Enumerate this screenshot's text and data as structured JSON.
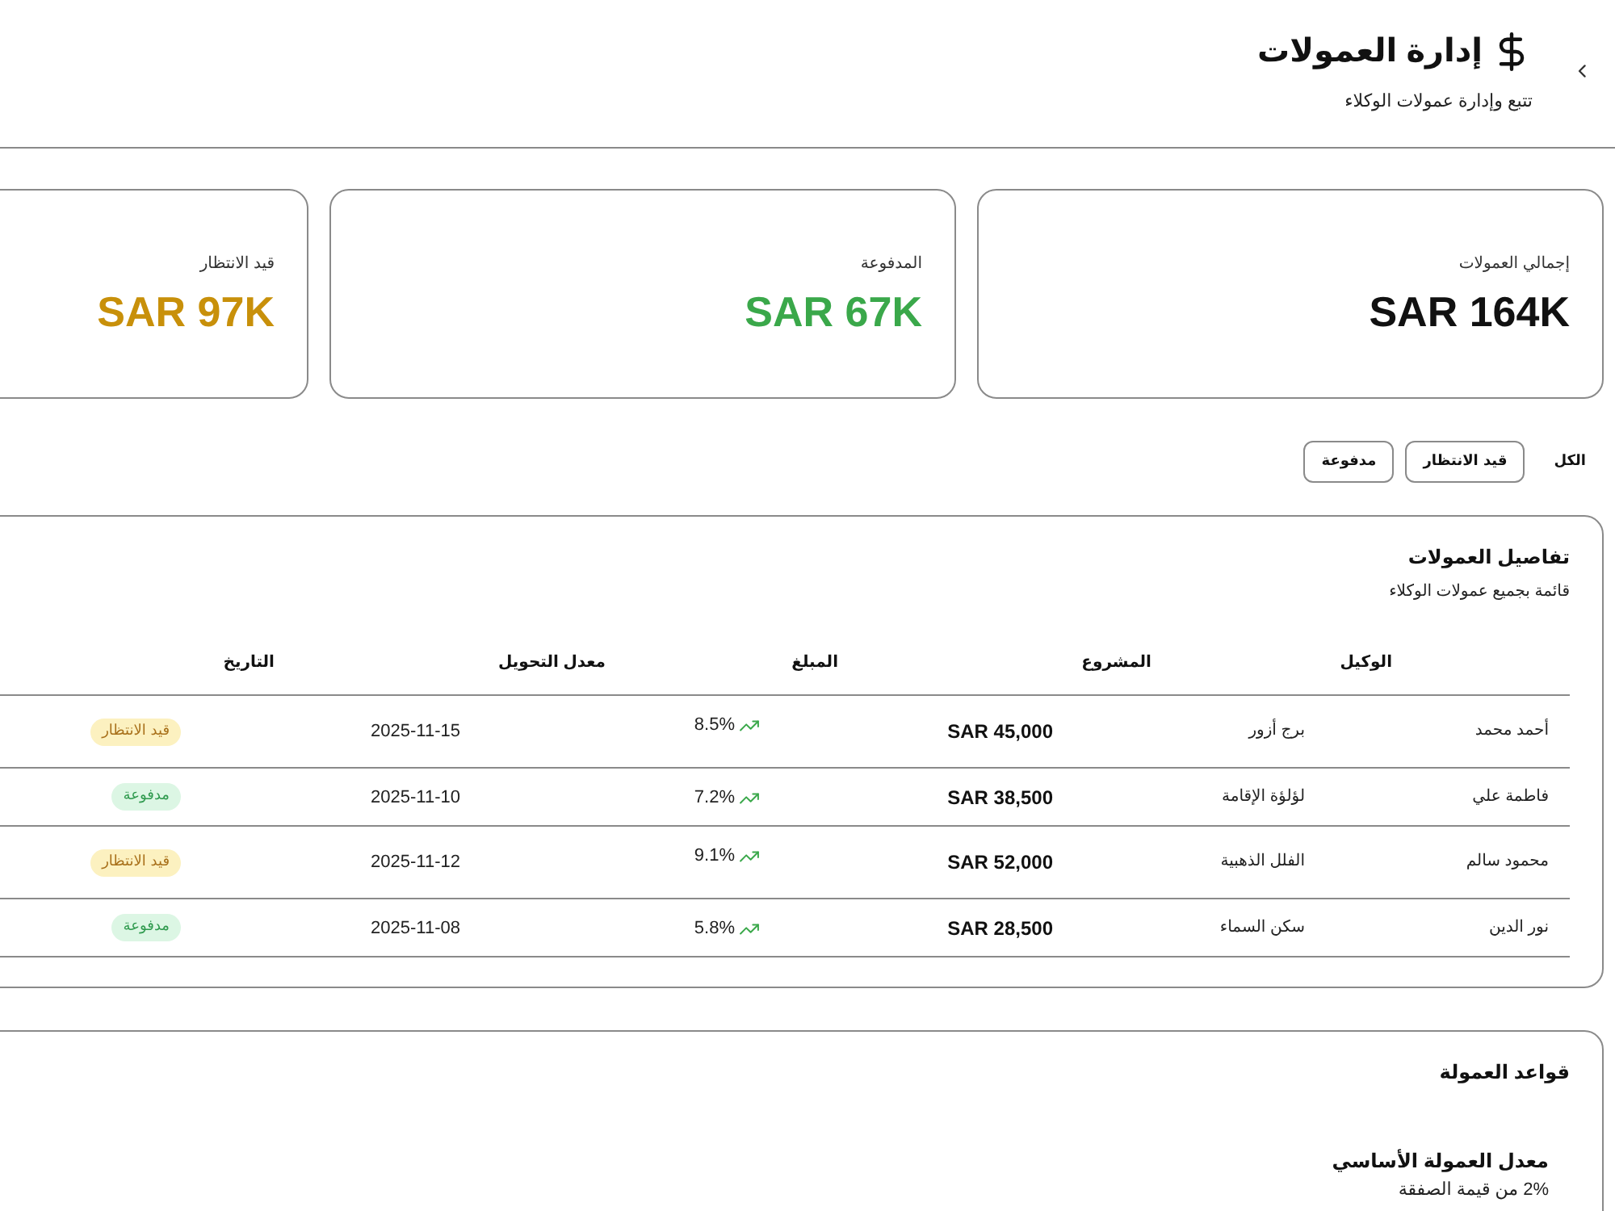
{
  "header": {
    "title": "إدارة العمولات",
    "subtitle": "تتبع وإدارة عمولات الوكلاء"
  },
  "stats": [
    {
      "label": "إجمالي العمولات",
      "value": "SAR 164K",
      "color": "#111111"
    },
    {
      "label": "المدفوعة",
      "value": "SAR 67K",
      "color": "#3aa84a"
    },
    {
      "label": "قيد الانتظار",
      "value": "SAR 97K",
      "color": "#c8900a"
    }
  ],
  "filters": [
    {
      "label": "الكل",
      "selected": true
    },
    {
      "label": "قيد الانتظار",
      "selected": false
    },
    {
      "label": "مدفوعة",
      "selected": false
    }
  ],
  "details": {
    "title": "تفاصيل العمولات",
    "subtitle": "قائمة بجميع عمولات الوكلاء",
    "columns": [
      "الوكيل",
      "المشروع",
      "المبلغ",
      "معدل التحويل",
      "التاريخ"
    ],
    "rows": [
      {
        "agent": "أحمد محمد",
        "project": "برج أزور",
        "amount": "SAR 45,000",
        "rate": "8.5%",
        "date": "2025-11-15",
        "status": {
          "label": "قيد الانتظار",
          "kind": "pending"
        }
      },
      {
        "agent": "فاطمة علي",
        "project": "لؤلؤة الإقامة",
        "amount": "SAR 38,500",
        "rate": "7.2%",
        "date": "2025-11-10",
        "status": {
          "label": "مدفوعة",
          "kind": "paid"
        }
      },
      {
        "agent": "محمود سالم",
        "project": "الفلل الذهبية",
        "amount": "SAR 52,000",
        "rate": "9.1%",
        "date": "2025-11-12",
        "status": {
          "label": "قيد الانتظار",
          "kind": "pending"
        }
      },
      {
        "agent": "نور الدين",
        "project": "سكن السماء",
        "amount": "SAR 28,500",
        "rate": "5.8%",
        "date": "2025-11-08",
        "status": {
          "label": "مدفوعة",
          "kind": "paid"
        }
      }
    ]
  },
  "rules": {
    "title": "قواعد العمولة",
    "items": [
      {
        "title": "معدل العمولة الأساسي",
        "description": "2% من قيمة الصفقة"
      }
    ]
  }
}
